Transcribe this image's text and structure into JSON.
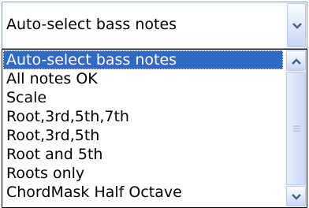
{
  "combo": {
    "selected_value": "Auto-select bass notes"
  },
  "list": {
    "items": [
      {
        "label": "Auto-select bass notes",
        "selected": true
      },
      {
        "label": "All notes OK",
        "selected": false
      },
      {
        "label": "Scale",
        "selected": false
      },
      {
        "label": "Root,3rd,5th,7th",
        "selected": false
      },
      {
        "label": "Root,3rd,5th",
        "selected": false
      },
      {
        "label": "Root and 5th",
        "selected": false
      },
      {
        "label": "Roots only",
        "selected": false
      },
      {
        "label": "ChordMask Half Octave",
        "selected": false
      }
    ]
  },
  "icons": {
    "dropdown": "chevron-down-icon",
    "scroll_up": "chevron-up-icon",
    "scroll_down": "chevron-down-icon",
    "grip": "scroll-grip-icon"
  },
  "colors": {
    "selection": "#316ac5",
    "border": "#7f9db9",
    "button_top": "#fafcff",
    "button_bottom": "#c6d6f7",
    "arrow": "#4d6185"
  }
}
